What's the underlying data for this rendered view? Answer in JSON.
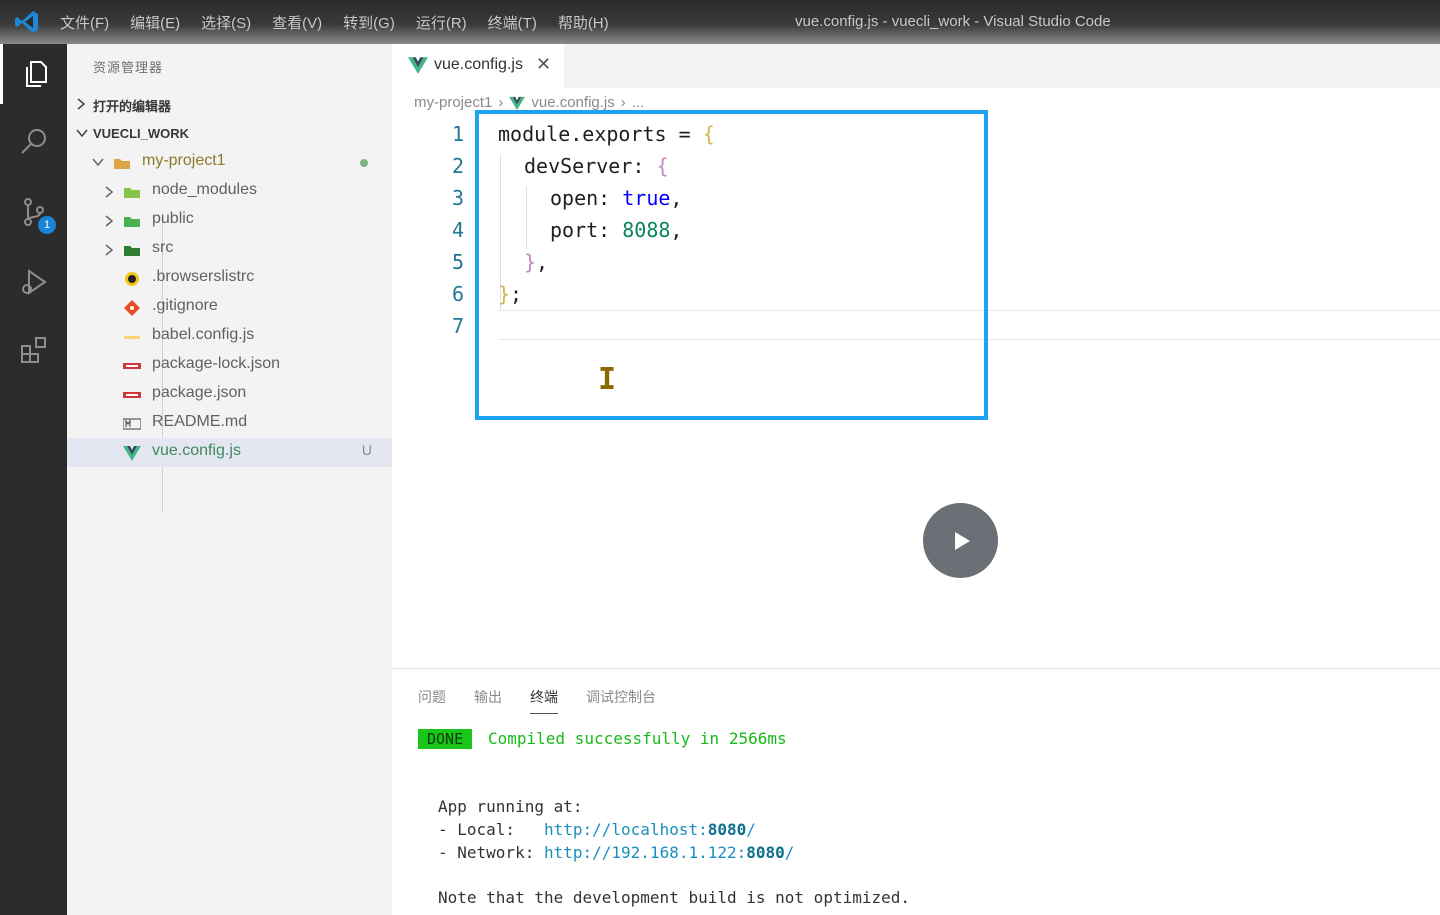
{
  "titlebar": {
    "menu": [
      "文件(F)",
      "编辑(E)",
      "选择(S)",
      "查看(V)",
      "转到(G)",
      "运行(R)",
      "终端(T)",
      "帮助(H)"
    ],
    "window_title": "vue.config.js - vuecli_work - Visual Studio Code"
  },
  "activity_bar": {
    "scm_badge": "1"
  },
  "sidebar": {
    "title": "资源管理器",
    "open_editors": "打开的编辑器",
    "workspace": "VUECLI_WORK",
    "tree": [
      {
        "name": "my-project1",
        "icon": "folder-icon"
      },
      {
        "name": "node_modules",
        "icon": "folder-node-icon"
      },
      {
        "name": "public",
        "icon": "folder-public-icon"
      },
      {
        "name": "src",
        "icon": "folder-src-icon"
      },
      {
        "name": ".browserslistrc",
        "icon": "browserslist-icon"
      },
      {
        "name": ".gitignore",
        "icon": "git-icon"
      },
      {
        "name": "babel.config.js",
        "icon": "babel-icon"
      },
      {
        "name": "package-lock.json",
        "icon": "npm-icon"
      },
      {
        "name": "package.json",
        "icon": "npm-icon"
      },
      {
        "name": "README.md",
        "icon": "markdown-icon"
      },
      {
        "name": "vue.config.js",
        "icon": "vue-icon",
        "status": "U"
      }
    ]
  },
  "editor": {
    "tab_label": "vue.config.js",
    "breadcrumb": [
      "my-project1",
      "vue.config.js",
      "..."
    ],
    "line_numbers": [
      "1",
      "2",
      "3",
      "4",
      "5",
      "6",
      "7"
    ],
    "code": {
      "l1_a": "module.exports = ",
      "l1_b": "{",
      "l2_a": "devServer: ",
      "l2_b": "{",
      "l3_a": "open: ",
      "l3_b": "true",
      "l3_c": ",",
      "l4_a": "port: ",
      "l4_b": "8088",
      "l4_c": ",",
      "l5_a": "}",
      "l5_b": ",",
      "l6_a": "}",
      "l6_b": ";"
    },
    "highlight_color": "#1ea3f0"
  },
  "panel": {
    "tabs": [
      "问题",
      "输出",
      "终端",
      "调试控制台"
    ],
    "active_tab": "终端",
    "done": "DONE",
    "compiled": "Compiled successfully in 2566ms",
    "app_running": "App running at:",
    "local_label": "- Local:   ",
    "local_url_a": "http://localhost:",
    "local_url_port": "8080",
    "local_url_b": "/",
    "network_label": "- Network: ",
    "network_url_a": "http://192.168.1.122:",
    "network_url_port": "8080",
    "network_url_b": "/",
    "note": "Note that the development build is not optimized."
  }
}
